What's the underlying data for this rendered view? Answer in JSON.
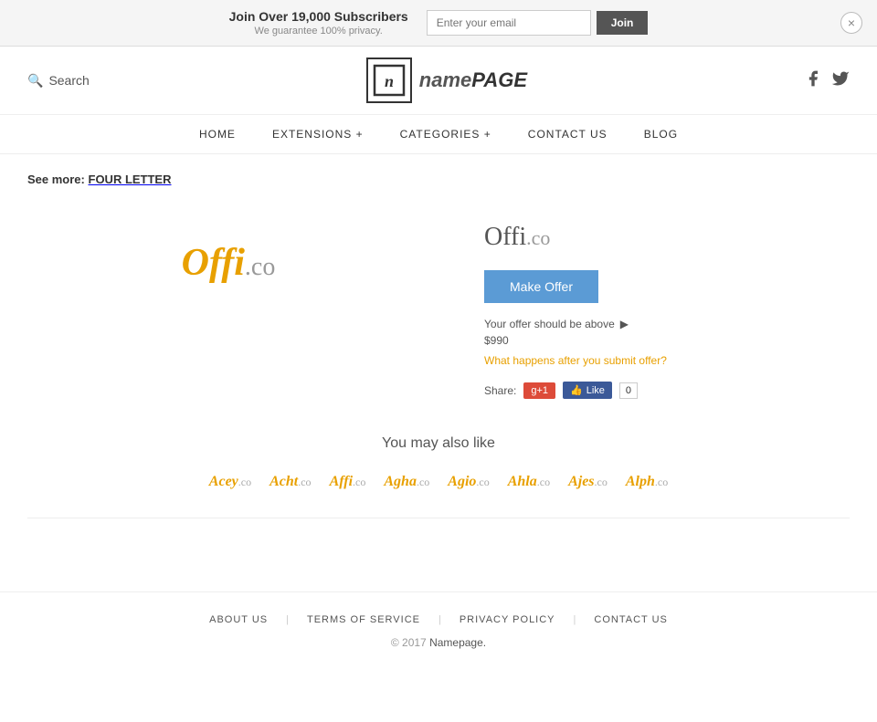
{
  "banner": {
    "title": "Join Over 19,000 Subscribers",
    "subtitle": "We guarantee 100% privacy.",
    "email_placeholder": "Enter your email",
    "join_label": "Join",
    "close_icon": "×"
  },
  "header": {
    "search_label": "Search",
    "logo_icon": "n",
    "logo_name": "name",
    "logo_page": "PAGE",
    "facebook_icon": "f",
    "twitter_icon": "t"
  },
  "nav": {
    "items": [
      {
        "label": "HOME",
        "id": "home"
      },
      {
        "label": "EXTENSIONS +",
        "id": "extensions"
      },
      {
        "label": "CATEGORIES +",
        "id": "categories"
      },
      {
        "label": "CONTACT US",
        "id": "contact"
      },
      {
        "label": "BLOG",
        "id": "blog"
      }
    ]
  },
  "breadcrumb": {
    "prefix": "See more:",
    "link_text": "FOUR LETTER"
  },
  "product": {
    "name": "Offi",
    "tld": ".co",
    "full_name": "Offi.co",
    "make_offer_label": "Make Offer",
    "offer_hint": "Your offer should be above",
    "offer_min": "$990",
    "offer_faq": "What happens after you submit offer?",
    "share_label": "Share:",
    "gplus_label": "g+1",
    "fb_like_label": "Like",
    "fb_count": "0"
  },
  "also_like": {
    "title": "You may also like",
    "items": [
      {
        "name": "Acey",
        "tld": ".co"
      },
      {
        "name": "Acht",
        "tld": ".co"
      },
      {
        "name": "Affi",
        "tld": ".co"
      },
      {
        "name": "Agha",
        "tld": ".co"
      },
      {
        "name": "Agio",
        "tld": ".co"
      },
      {
        "name": "Ahla",
        "tld": ".co"
      },
      {
        "name": "Ajes",
        "tld": ".co"
      },
      {
        "name": "Alph",
        "tld": ".co"
      }
    ]
  },
  "footer": {
    "links": [
      {
        "label": "ABOUT US",
        "id": "about"
      },
      {
        "label": "TERMS OF SERVICE",
        "id": "terms"
      },
      {
        "label": "PRIVACY POLICY",
        "id": "privacy"
      },
      {
        "label": "CONTACT US",
        "id": "contact"
      }
    ],
    "copyright": "© 2017",
    "brand": "Namepage."
  }
}
